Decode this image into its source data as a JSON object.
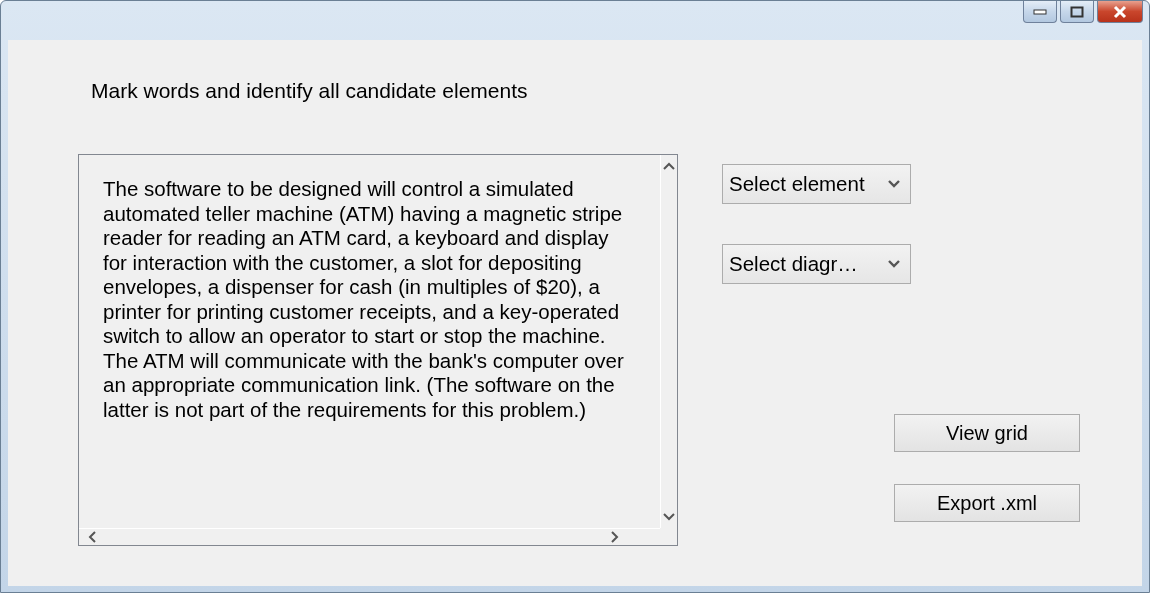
{
  "window": {
    "controls": [
      {
        "kind": "minimize"
      },
      {
        "kind": "maximize"
      },
      {
        "kind": "close"
      }
    ]
  },
  "instruction": "Mark words and identify all candidate elements",
  "text_area": {
    "value": "The software to be designed will control a simulated automated teller machine (ATM) having a magnetic stripe reader for reading an ATM card, a keyboard and display for interaction with the customer, a slot for depositing envelopes, a dispenser for cash (in multiples of $20), a printer for printing customer receipts, and a key-operated switch to allow an operator to start or stop the machine. The ATM will communicate with the bank's computer over an appropriate communication link. (The software on the latter is not part of the requirements for this problem.)"
  },
  "dropdowns": [
    {
      "value": "Select element"
    },
    {
      "value": "Select diagr…"
    }
  ],
  "buttons": [
    "View grid",
    "Export .xml"
  ]
}
